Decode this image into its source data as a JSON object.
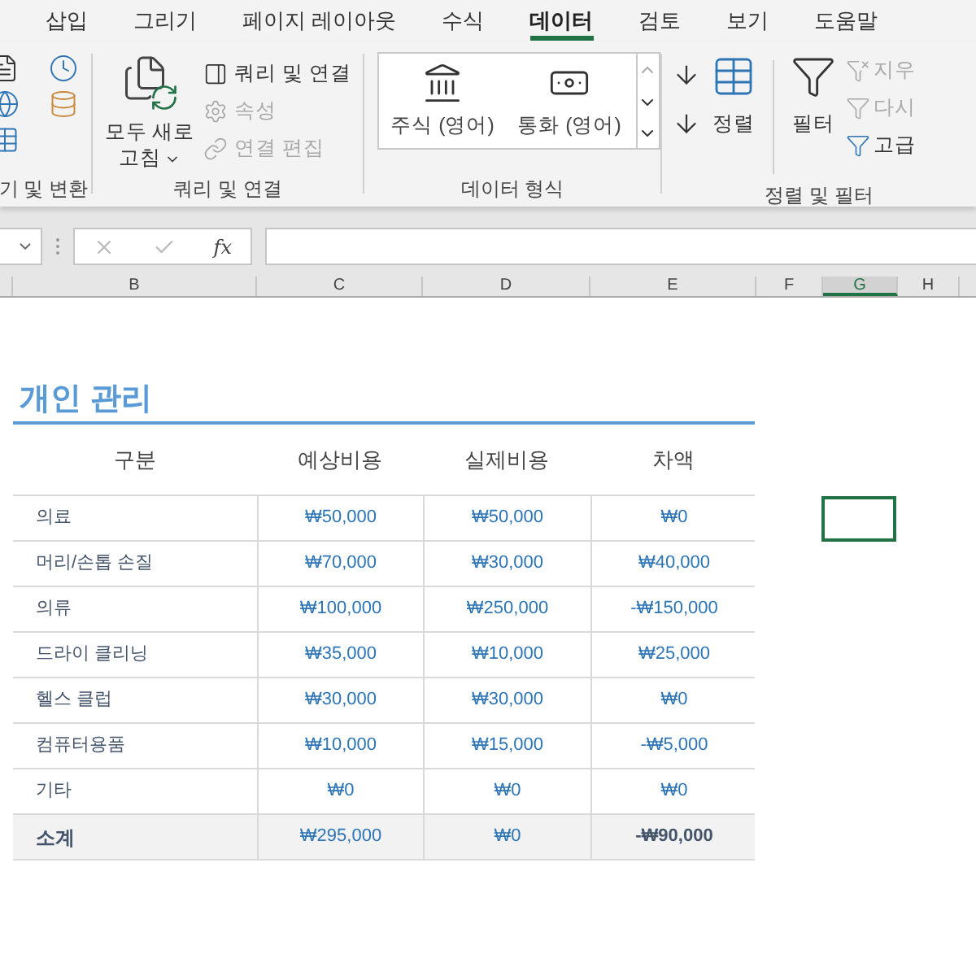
{
  "ribbon": {
    "tabs": [
      {
        "label": "삽입",
        "selected": false
      },
      {
        "label": "그리기",
        "selected": false
      },
      {
        "label": "페이지 레이아웃",
        "selected": false
      },
      {
        "label": "수식",
        "selected": false
      },
      {
        "label": "데이터",
        "selected": true
      },
      {
        "label": "검토",
        "selected": false
      },
      {
        "label": "보기",
        "selected": false
      },
      {
        "label": "도움말",
        "selected": false
      }
    ],
    "get_group": {
      "label": "기 및 변환"
    },
    "query_group": {
      "label": "쿼리 및 연결",
      "refresh": "모두 새로 고침",
      "items": [
        {
          "label": "쿼리 및 연결",
          "disabled": false
        },
        {
          "label": "속성",
          "disabled": true
        },
        {
          "label": "연결 편집",
          "disabled": true
        }
      ]
    },
    "types_group": {
      "label": "데이터 형식",
      "types": [
        {
          "kind": "stocks",
          "label": "주식 (영어)"
        },
        {
          "kind": "currency",
          "label": "통화 (영어)"
        }
      ]
    },
    "sort_group": {
      "label": "정렬 및 필터",
      "sort": "정렬",
      "filter": "필터",
      "items": [
        {
          "kind": "clear",
          "label": "지우",
          "disabled": true
        },
        {
          "kind": "reapply",
          "label": "다시",
          "disabled": true
        },
        {
          "kind": "advanced",
          "label": "고급",
          "disabled": false
        }
      ]
    }
  },
  "formula_bar": {
    "fx": "fx"
  },
  "columns": [
    {
      "label": "B",
      "selected": false
    },
    {
      "label": "C",
      "selected": false
    },
    {
      "label": "D",
      "selected": false
    },
    {
      "label": "E",
      "selected": false
    },
    {
      "label": "F",
      "selected": false
    },
    {
      "label": "G",
      "selected": true
    },
    {
      "label": "H",
      "selected": false
    }
  ],
  "sheet": {
    "title": "개인 관리",
    "headers": [
      "구분",
      "예상비용",
      "실제비용",
      "차액"
    ],
    "rows": [
      {
        "label": "의료",
        "values": [
          "₩50,000",
          "₩50,000",
          "₩0"
        ],
        "active_cell": true
      },
      {
        "label": "머리/손톱 손질",
        "values": [
          "₩70,000",
          "₩30,000",
          "₩40,000"
        ],
        "active_cell": false
      },
      {
        "label": "의류",
        "values": [
          "₩100,000",
          "₩250,000",
          "-₩150,000"
        ],
        "active_cell": false
      },
      {
        "label": "드라이 클리닝",
        "values": [
          "₩35,000",
          "₩10,000",
          "₩25,000"
        ],
        "active_cell": false
      },
      {
        "label": "헬스 클럽",
        "values": [
          "₩30,000",
          "₩30,000",
          "₩0"
        ],
        "active_cell": false
      },
      {
        "label": "컴퓨터용품",
        "values": [
          "₩10,000",
          "₩15,000",
          "-₩5,000"
        ],
        "active_cell": false
      },
      {
        "label": "기타",
        "values": [
          "₩0",
          "₩0",
          "₩0"
        ],
        "active_cell": false
      }
    ],
    "total": {
      "label": "소계",
      "values": [
        "₩295,000",
        "₩0",
        "-₩90,000"
      ]
    }
  }
}
